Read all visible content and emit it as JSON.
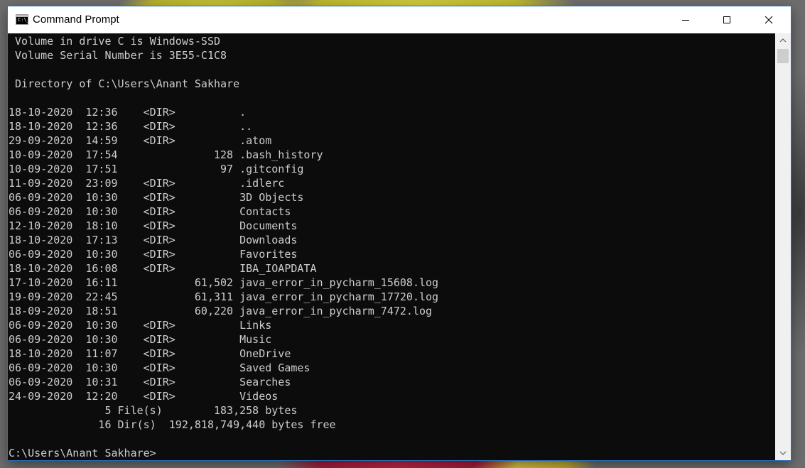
{
  "window": {
    "title": "Command Prompt",
    "icon": "cmd-icon",
    "icon_text": "C:\\_"
  },
  "controls": {
    "minimize": "minimize-icon",
    "maximize": "maximize-icon",
    "close": "close-icon"
  },
  "console": {
    "lines": [
      " Volume in drive C is Windows-SSD",
      " Volume Serial Number is 3E55-C1C8",
      "",
      " Directory of C:\\Users\\Anant Sakhare",
      "",
      "18-10-2020  12:36    <DIR>          .",
      "18-10-2020  12:36    <DIR>          ..",
      "29-09-2020  14:59    <DIR>          .atom",
      "10-09-2020  17:54               128 .bash_history",
      "10-09-2020  17:51                97 .gitconfig",
      "11-09-2020  23:09    <DIR>          .idlerc",
      "06-09-2020  10:30    <DIR>          3D Objects",
      "06-09-2020  10:30    <DIR>          Contacts",
      "12-10-2020  18:10    <DIR>          Documents",
      "18-10-2020  17:13    <DIR>          Downloads",
      "06-09-2020  10:30    <DIR>          Favorites",
      "18-10-2020  16:08    <DIR>          IBA_IOAPDATA",
      "17-10-2020  16:11            61,502 java_error_in_pycharm_15608.log",
      "19-09-2020  22:45            61,311 java_error_in_pycharm_17720.log",
      "18-09-2020  18:51            60,220 java_error_in_pycharm_7472.log",
      "06-09-2020  10:30    <DIR>          Links",
      "06-09-2020  10:30    <DIR>          Music",
      "18-10-2020  11:07    <DIR>          OneDrive",
      "06-09-2020  10:30    <DIR>          Saved Games",
      "06-09-2020  10:31    <DIR>          Searches",
      "24-09-2020  12:20    <DIR>          Videos",
      "               5 File(s)        183,258 bytes",
      "              16 Dir(s)  192,818,749,440 bytes free",
      "",
      "C:\\Users\\Anant Sakhare>"
    ]
  },
  "colors": {
    "console_bg": "#0c0c0c",
    "console_text": "#cccccc",
    "titlebar_bg": "#ffffff"
  }
}
